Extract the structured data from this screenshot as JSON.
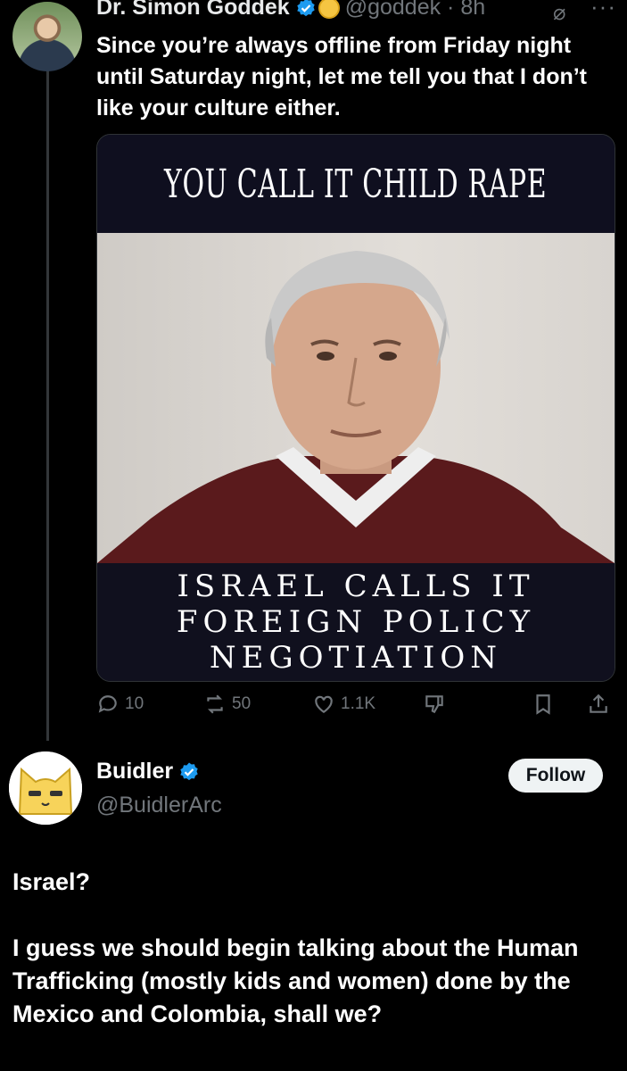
{
  "tweet": {
    "author_name": "Dr. Simon Goddek",
    "handle_time": "@goddek · 8h",
    "more": "···",
    "text": "Since you’re always offline from Friday night until Saturday night, let me tell you that I don’t like your culture either.",
    "media": {
      "top_caption": "YOU CALL IT CHILD RAPE",
      "bottom_caption_lines": [
        "ISRAEL CALLS IT",
        "FOREIGN POLICY",
        "NEGOTIATION"
      ]
    },
    "stats": {
      "replies": "10",
      "reposts": "50",
      "likes": "1.1K"
    }
  },
  "reply": {
    "author_name": "Buidler",
    "handle": "@BuidlerArc",
    "follow_label": "Follow",
    "paragraphs": [
      "Israel?",
      "I guess we should begin talking about the Human Trafficking (mostly kids and women) done by the Mexico and Colombia, shall we?"
    ]
  },
  "colors": {
    "background": "#000000",
    "verified": "#1d9bf0",
    "muted": "#71767b",
    "follow_bg": "#eff3f4"
  },
  "icons": [
    "verified-badge-icon",
    "gold-coin-icon",
    "grok-icon",
    "more-icon",
    "reply-icon",
    "repost-icon",
    "like-icon",
    "dislike-icon",
    "bookmark-icon",
    "share-icon"
  ]
}
